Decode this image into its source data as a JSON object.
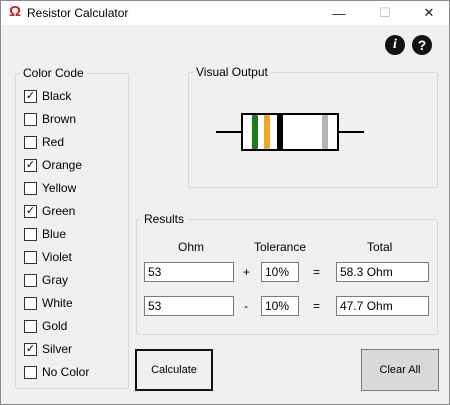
{
  "window": {
    "title": "Resistor Calculator",
    "icon_glyph": "Ω",
    "icon_name": "ohm-icon",
    "minimize_glyph": "—",
    "maximize_glyph": "☐",
    "close_glyph": "✕"
  },
  "help": {
    "info_glyph": "i",
    "question_glyph": "?"
  },
  "color_code": {
    "title": "Color Code",
    "items": [
      {
        "label": "Black",
        "checked": true,
        "mark": "✓"
      },
      {
        "label": "Brown",
        "checked": false,
        "mark": ""
      },
      {
        "label": "Red",
        "checked": false,
        "mark": ""
      },
      {
        "label": "Orange",
        "checked": true,
        "mark": "✓"
      },
      {
        "label": "Yellow",
        "checked": false,
        "mark": ""
      },
      {
        "label": "Green",
        "checked": true,
        "mark": "✓"
      },
      {
        "label": "Blue",
        "checked": false,
        "mark": ""
      },
      {
        "label": "Violet",
        "checked": false,
        "mark": ""
      },
      {
        "label": "Gray",
        "checked": false,
        "mark": ""
      },
      {
        "label": "White",
        "checked": false,
        "mark": ""
      },
      {
        "label": "Gold",
        "checked": false,
        "mark": ""
      },
      {
        "label": "Silver",
        "checked": true,
        "mark": "✓"
      },
      {
        "label": "No Color",
        "checked": false,
        "mark": ""
      }
    ]
  },
  "visual_output": {
    "title": "Visual Output",
    "bands": [
      {
        "name": "green",
        "color": "#1e7a1e"
      },
      {
        "name": "orange",
        "color": "#f5a623"
      },
      {
        "name": "black",
        "color": "#000000"
      },
      {
        "name": "silver",
        "color": "#b5b5b5"
      }
    ]
  },
  "results": {
    "title": "Results",
    "headers": {
      "ohm": "Ohm",
      "tolerance": "Tolerance",
      "total": "Total"
    },
    "rows": [
      {
        "ohm": "53",
        "op": "+",
        "tolerance": "10%",
        "eq": "=",
        "total": "58.3 Ohm"
      },
      {
        "ohm": "53",
        "op": "-",
        "tolerance": "10%",
        "eq": "=",
        "total": "47.7 Ohm"
      }
    ]
  },
  "buttons": {
    "calculate": "Calculate",
    "clear_all": "Clear All"
  }
}
